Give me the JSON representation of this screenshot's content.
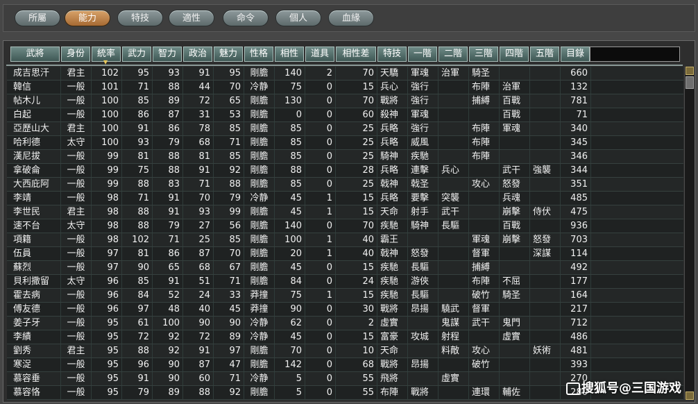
{
  "tabs": [
    "所屬",
    "能力",
    "特技",
    "適性",
    "命令",
    "個人",
    "血緣"
  ],
  "active_tab": 1,
  "columns": [
    "武將",
    "身份",
    "統率",
    "武力",
    "智力",
    "政治",
    "魅力",
    "性格",
    "相性",
    "道具",
    "相性差",
    "特技",
    "一階",
    "二階",
    "三階",
    "四階",
    "五階",
    "目錄"
  ],
  "sorted_column": "統率",
  "rows": [
    [
      "成吉思汗",
      "君主",
      "102",
      "95",
      "93",
      "91",
      "95",
      "剛膽",
      "140",
      "2",
      "70",
      "天驕",
      "軍魂",
      "治軍",
      "騎圣",
      "",
      "",
      "660"
    ],
    [
      "韓信",
      "一般",
      "101",
      "71",
      "88",
      "44",
      "70",
      "冷静",
      "75",
      "0",
      "15",
      "兵心",
      "強行",
      "",
      "布陣",
      "治軍",
      "",
      "132"
    ],
    [
      "帖木儿",
      "一般",
      "100",
      "85",
      "89",
      "72",
      "65",
      "剛膽",
      "130",
      "0",
      "70",
      "戰將",
      "強行",
      "",
      "捕縛",
      "百戰",
      "",
      "781"
    ],
    [
      "白起",
      "一般",
      "100",
      "86",
      "87",
      "31",
      "53",
      "剛膽",
      "0",
      "0",
      "60",
      "殺神",
      "軍魂",
      "",
      "",
      "百戰",
      "",
      "71"
    ],
    [
      "亞歷山大",
      "君主",
      "100",
      "91",
      "86",
      "78",
      "85",
      "剛膽",
      "85",
      "0",
      "25",
      "兵略",
      "強行",
      "",
      "布陣",
      "軍魂",
      "",
      "340"
    ],
    [
      "哈利德",
      "太守",
      "100",
      "93",
      "79",
      "68",
      "71",
      "剛膽",
      "85",
      "0",
      "25",
      "兵略",
      "威風",
      "",
      "布陣",
      "",
      "",
      "345"
    ],
    [
      "漢尼拔",
      "一般",
      "99",
      "81",
      "88",
      "81",
      "85",
      "剛膽",
      "85",
      "0",
      "25",
      "騎神",
      "疾馳",
      "",
      "布陣",
      "",
      "",
      "346"
    ],
    [
      "拿破侖",
      "一般",
      "99",
      "75",
      "88",
      "91",
      "92",
      "剛膽",
      "88",
      "0",
      "28",
      "兵略",
      "連擊",
      "兵心",
      "",
      "武干",
      "強襲",
      "344"
    ],
    [
      "大西庇阿",
      "一般",
      "99",
      "88",
      "83",
      "71",
      "88",
      "剛膽",
      "85",
      "0",
      "25",
      "戟神",
      "戟圣",
      "",
      "攻心",
      "怒發",
      "",
      "351"
    ],
    [
      "李靖",
      "一般",
      "98",
      "71",
      "91",
      "70",
      "79",
      "冷静",
      "45",
      "1",
      "15",
      "兵略",
      "要擊",
      "突襲",
      "",
      "兵魂",
      "",
      "485"
    ],
    [
      "李世民",
      "君主",
      "98",
      "88",
      "91",
      "93",
      "99",
      "剛膽",
      "45",
      "1",
      "15",
      "天命",
      "射手",
      "武干",
      "",
      "崩擊",
      "侍伏",
      "475"
    ],
    [
      "速不台",
      "太守",
      "98",
      "88",
      "79",
      "27",
      "56",
      "剛膽",
      "140",
      "0",
      "70",
      "疾馳",
      "騎神",
      "長驅",
      "",
      "百戰",
      "",
      "936"
    ],
    [
      "項籍",
      "一般",
      "98",
      "102",
      "71",
      "25",
      "85",
      "剛膽",
      "100",
      "1",
      "40",
      "霸王",
      "",
      "",
      "軍魂",
      "崩擊",
      "怒發",
      "703"
    ],
    [
      "伍員",
      "一般",
      "97",
      "81",
      "86",
      "87",
      "70",
      "剛膽",
      "20",
      "1",
      "40",
      "戟神",
      "怒發",
      "",
      "督軍",
      "",
      "深謀",
      "114"
    ],
    [
      "蘇烈",
      "一般",
      "97",
      "90",
      "65",
      "68",
      "67",
      "剛膽",
      "45",
      "0",
      "15",
      "疾馳",
      "長驅",
      "",
      "捕縛",
      "",
      "",
      "492"
    ],
    [
      "貝利撒留",
      "太守",
      "96",
      "85",
      "91",
      "51",
      "71",
      "剛膽",
      "84",
      "0",
      "24",
      "疾馳",
      "游俠",
      "",
      "布陣",
      "不屈",
      "",
      "177"
    ],
    [
      "霍去病",
      "一般",
      "96",
      "84",
      "52",
      "24",
      "33",
      "莽撞",
      "75",
      "1",
      "15",
      "疾馳",
      "長驅",
      "",
      "破竹",
      "騎圣",
      "",
      "164"
    ],
    [
      "傅友德",
      "一般",
      "96",
      "97",
      "48",
      "40",
      "45",
      "莽撞",
      "90",
      "0",
      "30",
      "戰將",
      "昂揚",
      "驍武",
      "督軍",
      "",
      "",
      "217"
    ],
    [
      "姜子牙",
      "一般",
      "95",
      "61",
      "100",
      "90",
      "90",
      "冷静",
      "62",
      "0",
      "2",
      "虛實",
      "",
      "鬼謀",
      "武干",
      "鬼門",
      "",
      "712"
    ],
    [
      "李績",
      "一般",
      "95",
      "72",
      "92",
      "72",
      "89",
      "冷静",
      "45",
      "0",
      "15",
      "富豪",
      "攻城",
      "射程",
      "",
      "虛實",
      "",
      "486"
    ],
    [
      "劉秀",
      "君主",
      "95",
      "88",
      "92",
      "91",
      "97",
      "剛膽",
      "70",
      "0",
      "10",
      "天命",
      "",
      "料敵",
      "攻心",
      "",
      "妖術",
      "481"
    ],
    [
      "寒浞",
      "一般",
      "95",
      "96",
      "90",
      "87",
      "47",
      "剛膽",
      "142",
      "0",
      "68",
      "戰將",
      "昂揚",
      "",
      "破竹",
      "",
      "",
      "393"
    ],
    [
      "慕容垂",
      "一般",
      "95",
      "91",
      "90",
      "60",
      "71",
      "冷静",
      "5",
      "0",
      "55",
      "飛將",
      "",
      "虛實",
      "",
      "",
      "",
      "270"
    ],
    [
      "慕容恪",
      "一般",
      "95",
      "79",
      "89",
      "88",
      "92",
      "剛膽",
      "5",
      "0",
      "55",
      "布陣",
      "戰將",
      "",
      "連環",
      "輔佐",
      "",
      "280"
    ]
  ],
  "watermark": "搜狐号@三国游戏"
}
